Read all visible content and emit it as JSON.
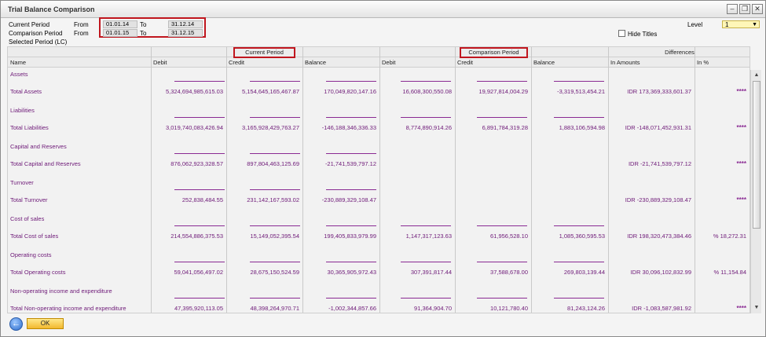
{
  "window": {
    "title": "Trial Balance Comparison",
    "controls": {
      "minimize": "–",
      "restore": "❐",
      "close": "✕"
    }
  },
  "filters": {
    "current_period_label": "Current Period",
    "comparison_period_label": "Comparison Period",
    "selected_period_label": "Selected Period (LC)",
    "from_label": "From",
    "to_label": "To",
    "current_from": "01.01.14",
    "current_to": "31.12.14",
    "comparison_from": "01.01.15",
    "comparison_to": "31.12.15",
    "level_label": "Level",
    "level_value": "1",
    "hide_titles_label": "Hide Titles"
  },
  "table": {
    "group_headers": {
      "current": "Current Period",
      "comparison": "Comparison Period",
      "differences": "Differences"
    },
    "columns": [
      "Name",
      "Debit",
      "Credit",
      "Balance",
      "Debit",
      "Credit",
      "Balance",
      "In Amounts",
      "In %"
    ],
    "rows": [
      {
        "title": "Assets",
        "total": "Total Assets",
        "cur_debit": "5,324,694,985,615.03",
        "cur_credit": "5,154,645,165,467.87",
        "cur_balance": "170,049,820,147.16",
        "cmp_debit": "16,608,300,550.08",
        "cmp_credit": "19,927,814,004.29",
        "cmp_balance": "-3,319,513,454.21",
        "diff_amount": "IDR 173,369,333,601.37",
        "diff_pct": "****"
      },
      {
        "title": "Liabilities",
        "total": "Total Liabilities",
        "cur_debit": "3,019,740,083,426.94",
        "cur_credit": "3,165,928,429,763.27",
        "cur_balance": "-146,188,346,336.33",
        "cmp_debit": "8,774,890,914.26",
        "cmp_credit": "6,891,784,319.28",
        "cmp_balance": "1,883,106,594.98",
        "diff_amount": "IDR -148,071,452,931.31",
        "diff_pct": "****"
      },
      {
        "title": "Capital and Reserves",
        "total": "Total Capital and Reserves",
        "cur_debit": "876,062,923,328.57",
        "cur_credit": "897,804,463,125.69",
        "cur_balance": "-21,741,539,797.12",
        "cmp_debit": "",
        "cmp_credit": "",
        "cmp_balance": "",
        "diff_amount": "IDR -21,741,539,797.12",
        "diff_pct": "****"
      },
      {
        "title": "Turnover",
        "total": "Total Turnover",
        "cur_debit": "252,838,484.55",
        "cur_credit": "231,142,167,593.02",
        "cur_balance": "-230,889,329,108.47",
        "cmp_debit": "",
        "cmp_credit": "",
        "cmp_balance": "",
        "diff_amount": "IDR -230,889,329,108.47",
        "diff_pct": "****"
      },
      {
        "title": "Cost of sales",
        "total": "Total Cost of sales",
        "cur_debit": "214,554,886,375.53",
        "cur_credit": "15,149,052,395.54",
        "cur_balance": "199,405,833,979.99",
        "cmp_debit": "1,147,317,123.63",
        "cmp_credit": "61,956,528.10",
        "cmp_balance": "1,085,360,595.53",
        "diff_amount": "IDR 198,320,473,384.46",
        "diff_pct": "% 18,272.31"
      },
      {
        "title": "Operating costs",
        "total": "Total Operating costs",
        "cur_debit": "59,041,056,497.02",
        "cur_credit": "28,675,150,524.59",
        "cur_balance": "30,365,905,972.43",
        "cmp_debit": "307,391,817.44",
        "cmp_credit": "37,588,678.00",
        "cmp_balance": "269,803,139.44",
        "diff_amount": "IDR 30,096,102,832.99",
        "diff_pct": "% 11,154.84"
      },
      {
        "title": "Non-operating income and expenditure",
        "total": "Total Non-operating income and expenditure",
        "cur_debit": "47,395,920,113.05",
        "cur_credit": "48,398,264,970.71",
        "cur_balance": "-1,002,344,857.66",
        "cmp_debit": "91,364,904.70",
        "cmp_credit": "10,121,780.40",
        "cmp_balance": "81,243,124.26",
        "diff_amount": "IDR -1,083,587,981.92",
        "diff_pct": "****"
      }
    ]
  },
  "footer": {
    "back_icon": "back-arrow-icon",
    "ok_label": "OK"
  }
}
